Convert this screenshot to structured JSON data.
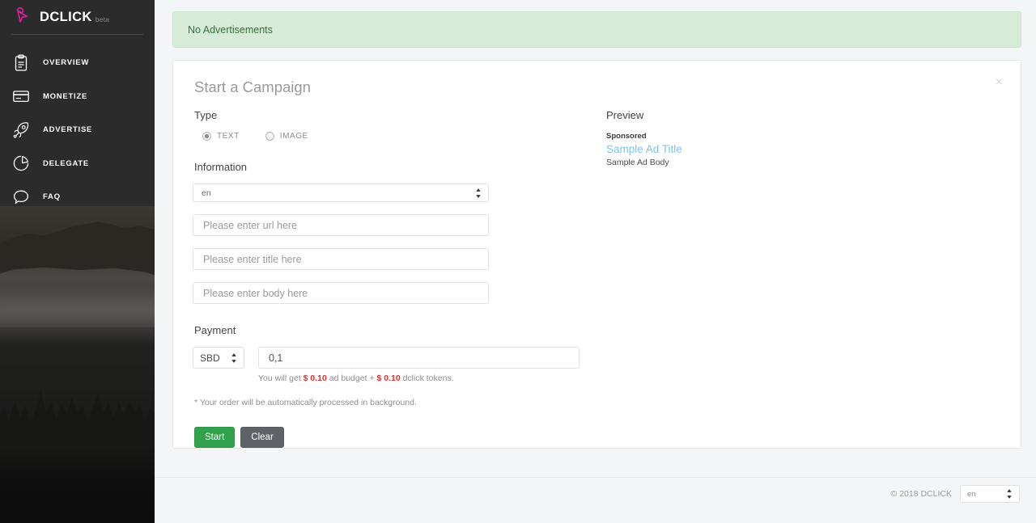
{
  "sidebar": {
    "brand": {
      "name": "DCLICK",
      "beta": "beta",
      "icon": "cursor-click-icon"
    },
    "items": [
      {
        "label": "OVERVIEW",
        "icon": "clipboard-icon"
      },
      {
        "label": "MONETIZE",
        "icon": "credit-card-icon"
      },
      {
        "label": "ADVERTISE",
        "icon": "rocket-icon"
      },
      {
        "label": "DELEGATE",
        "icon": "pie-chart-icon"
      },
      {
        "label": "FAQ",
        "icon": "speech-bubble-icon"
      }
    ]
  },
  "alert": {
    "text": "No Advertisements"
  },
  "card": {
    "title": "Start a Campaign",
    "close_label": "×",
    "type": {
      "label": "Type",
      "options": [
        {
          "label": "TEXT",
          "selected": true
        },
        {
          "label": "IMAGE",
          "selected": false
        }
      ]
    },
    "information": {
      "label": "Information",
      "language_value": "en",
      "url_placeholder": "Please enter url here",
      "url_value": "",
      "title_placeholder": "Please enter title here",
      "title_value": "",
      "body_placeholder": "Please enter body here",
      "body_value": ""
    },
    "payment": {
      "label": "Payment",
      "currency_value": "SBD",
      "amount_value": "0,1",
      "amount_placeholder": "",
      "hint_prefix": "You will get ",
      "hint_budget_amount": "$ 0.10",
      "hint_middle": " ad budget + ",
      "hint_token_amount": "$ 0.10",
      "hint_suffix": " dclick tokens.",
      "note": "* Your order will be automatically processed in background."
    },
    "buttons": {
      "start": "Start",
      "clear": "Clear"
    },
    "preview": {
      "label": "Preview",
      "sponsored": "Sponsored",
      "ad_title": "Sample Ad Title",
      "ad_body": "Sample Ad Body"
    }
  },
  "footer": {
    "copyright": "© 2018 DCLICK",
    "language_value": "en"
  },
  "colors": {
    "brand_pink": "#d6219b",
    "sidebar_bg": "#2b2b2b",
    "alert_bg": "#d6ecd8",
    "alert_text": "#3b6b40",
    "start_green": "#31a24c",
    "clear_gray": "#5f6368",
    "amount_red": "#e03131",
    "preview_link": "#7ec3e8",
    "page_bg": "#f4f5f7"
  }
}
